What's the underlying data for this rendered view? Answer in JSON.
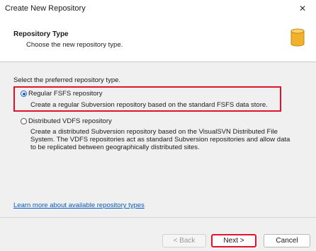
{
  "window": {
    "title": "Create New Repository",
    "close_glyph": "✕"
  },
  "header": {
    "title": "Repository Type",
    "subtitle": "Choose the new repository type.",
    "icon": "database-icon"
  },
  "body": {
    "prompt": "Select the preferred repository type.",
    "options": [
      {
        "label": "Regular FSFS repository",
        "description": "Create a regular Subversion repository based on the standard FSFS data store.",
        "selected": true
      },
      {
        "label": "Distributed VDFS repository",
        "description_lines": [
          "Create a distributed Subversion repository based on the VisualSVN Distributed File",
          "System. The VDFS repositories act as standard Subversion repositories and allow data",
          "to be replicated between geographically distributed sites."
        ],
        "selected": false
      }
    ],
    "learn_more_link": "Learn more about available repository types"
  },
  "footer": {
    "back_label": "< Back",
    "next_label": "Next >",
    "cancel_label": "Cancel"
  },
  "colors": {
    "highlight": "#e2142d",
    "link": "#0d5bc2",
    "radio_accent": "#1a62c5",
    "db_icon": "#f2b12b"
  }
}
